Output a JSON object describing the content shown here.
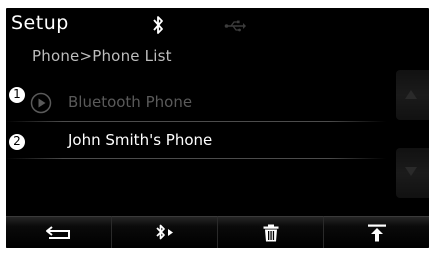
{
  "screen": {
    "title": "Setup",
    "status_icons": [
      "bluetooth-icon",
      "usb-icon"
    ],
    "breadcrumb": "Phone>Phone List"
  },
  "phone_list": {
    "items": [
      {
        "label": "Bluetooth Phone",
        "state": "disabled",
        "icon": "play-circle-icon"
      },
      {
        "label": "John Smith's Phone",
        "state": "active"
      }
    ]
  },
  "scroll": {
    "up_icon": "arrow-up-icon",
    "down_icon": "arrow-down-icon"
  },
  "bottom_buttons": [
    {
      "name": "back",
      "icon": "back-arrow-icon"
    },
    {
      "name": "bluetooth-connect",
      "icon": "bluetooth-play-icon"
    },
    {
      "name": "delete",
      "icon": "trash-icon"
    },
    {
      "name": "home",
      "icon": "upload-arrow-icon"
    }
  ],
  "callouts": [
    "1",
    "2"
  ],
  "colors": {
    "screen_bg": "#000000",
    "title": "#ffffff",
    "breadcrumb": "#bdbdbd",
    "disabled_text": "#5a5a5a",
    "active_text": "#ffffff"
  }
}
